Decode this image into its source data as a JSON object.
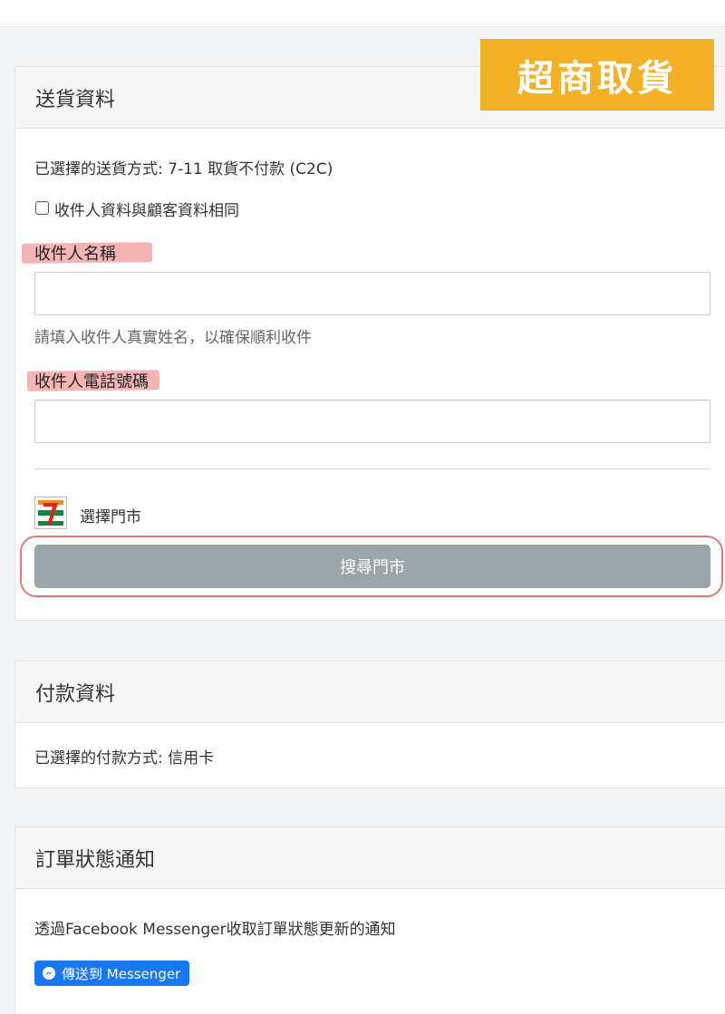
{
  "banner": {
    "text": "超商取貨",
    "color": "#f4b125"
  },
  "shipping": {
    "title": "送貨資料",
    "selected_method": "已選擇的送貨方式: 7-11 取貨不付款 (C2C)",
    "same_as_customer_label": "收件人資料與顧客資料相同",
    "same_as_customer_checked": false,
    "recipient_name_label": "收件人名稱",
    "recipient_name_value": "",
    "recipient_name_help": "請填入收件人真實姓名，以確保順利收件",
    "recipient_phone_label": "收件人電話號碼",
    "recipient_phone_value": "",
    "store_logo_icon": "seven-eleven-logo-icon",
    "choose_store_label": "選擇門市",
    "search_store_button": "搜尋門市"
  },
  "payment": {
    "title": "付款資料",
    "selected_method": "已選擇的付款方式: 信用卡"
  },
  "notify": {
    "title": "訂單狀態通知",
    "description": "透過Facebook Messenger收取訂單狀態更新的通知",
    "messenger_button": "傳送到 Messenger",
    "messenger_icon": "messenger-icon",
    "messenger_color": "#1877f2"
  }
}
